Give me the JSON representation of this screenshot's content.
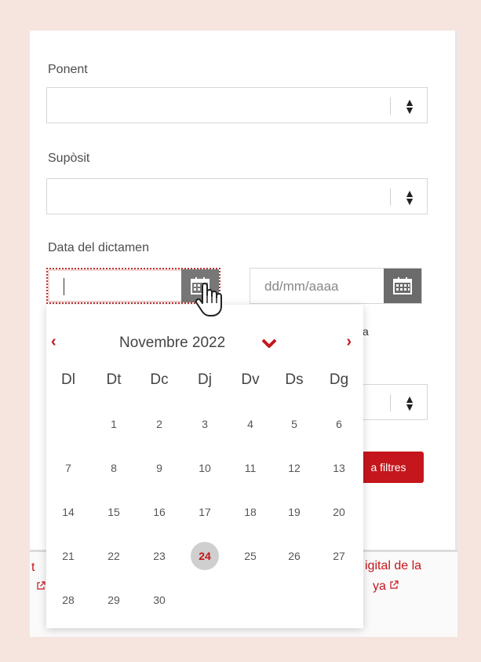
{
  "form": {
    "ponent_label": "Ponent",
    "suposit_label": "Supòsit",
    "date_label": "Data del dictamen",
    "date_to_placeholder": "dd/mm/aaaa",
    "filter_button_fragment": "a filtres",
    "partial_label_fragment": "a"
  },
  "footer": {
    "left_fragment_1": "t",
    "left_fragment_2": "☐",
    "right_fragment_1": "igital de la",
    "right_fragment_2": "ya"
  },
  "calendar": {
    "prev": "‹",
    "next": "›",
    "month_title": "Novembre 2022",
    "weekdays": [
      "Dl",
      "Dt",
      "Dc",
      "Dj",
      "Dv",
      "Ds",
      "Dg"
    ],
    "weeks": [
      [
        "",
        "1",
        "2",
        "3",
        "4",
        "5",
        "6"
      ],
      [
        "7",
        "8",
        "9",
        "10",
        "11",
        "12",
        "13"
      ],
      [
        "14",
        "15",
        "16",
        "17",
        "18",
        "19",
        "20"
      ],
      [
        "21",
        "22",
        "23",
        "24",
        "25",
        "26",
        "27"
      ],
      [
        "28",
        "29",
        "30",
        "",
        "",
        "",
        ""
      ]
    ],
    "today": "24"
  },
  "colors": {
    "accent": "#c4161c",
    "background": "#f6e5de"
  }
}
